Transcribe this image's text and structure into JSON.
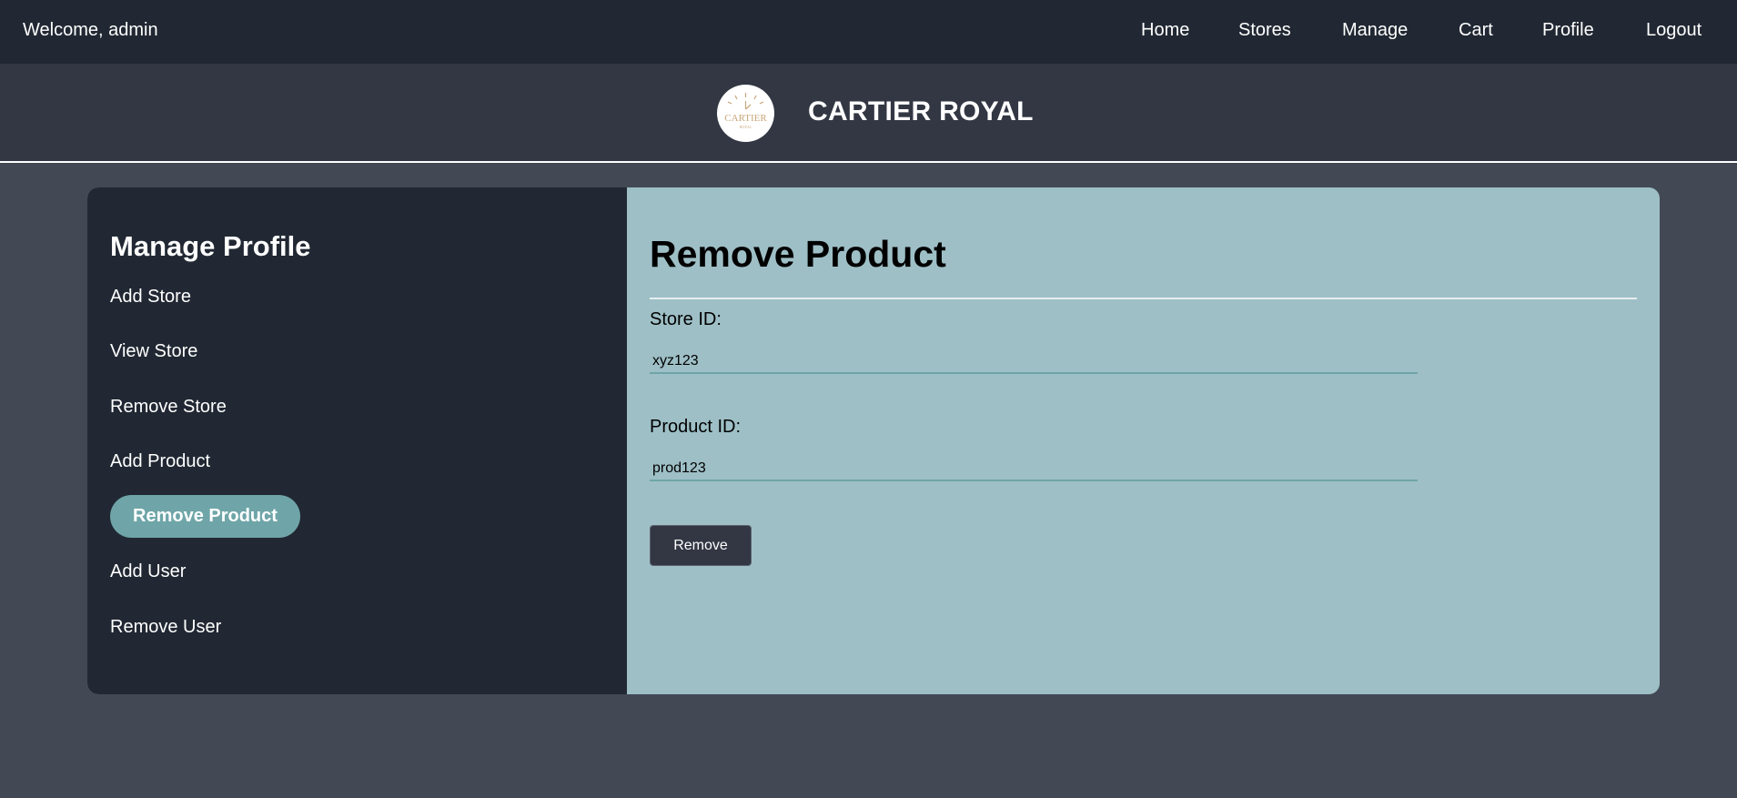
{
  "header": {
    "welcome": "Welcome, admin",
    "nav": [
      "Home",
      "Stores",
      "Manage",
      "Cart",
      "Profile",
      "Logout"
    ]
  },
  "brand": {
    "title": "CARTIER ROYAL",
    "logo_text": "CARTIER",
    "logo_subtext": "ROYAL"
  },
  "sidebar": {
    "title": "Manage Profile",
    "items": [
      {
        "label": "Add Store",
        "active": false
      },
      {
        "label": "View Store",
        "active": false
      },
      {
        "label": "Remove Store",
        "active": false
      },
      {
        "label": "Add Product",
        "active": false
      },
      {
        "label": "Remove Product",
        "active": true
      },
      {
        "label": "Add User",
        "active": false
      },
      {
        "label": "Remove User",
        "active": false
      }
    ]
  },
  "form": {
    "title": "Remove Product",
    "store_label": "Store ID:",
    "store_value": "xyz123",
    "product_label": "Product ID:",
    "product_value": "prod123",
    "submit_label": "Remove"
  },
  "colors": {
    "topnav": "#212833",
    "brandbar": "#323743",
    "page": "#424955",
    "sidebar": "#212833",
    "panel": "#9ebfc6",
    "accent": "#6fa5a8",
    "button": "#323743"
  }
}
